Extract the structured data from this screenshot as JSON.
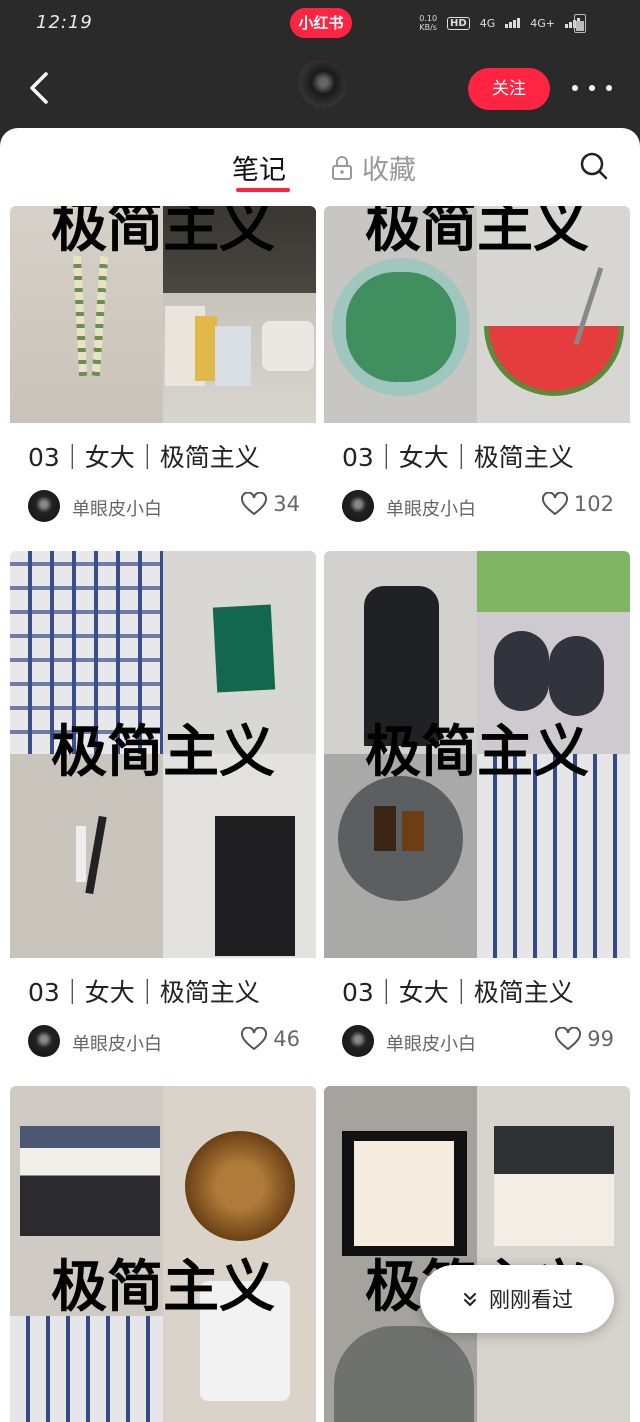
{
  "status": {
    "time": "12:19",
    "brand": "小红书",
    "net_speed_top": "0.10",
    "net_speed_bottom": "KB/s",
    "hd": "HD",
    "net1": "4G",
    "net2": "4G+"
  },
  "header": {
    "follow_label": "关注"
  },
  "tabs": {
    "notes": "笔记",
    "favorites": "收藏"
  },
  "notes": [
    {
      "title": "03｜女大｜极简主义",
      "author": "单眼皮小白",
      "likes": "34",
      "overlay": "极简主义"
    },
    {
      "title": "03｜女大｜极简主义",
      "author": "单眼皮小白",
      "likes": "102",
      "overlay": "极简主义"
    },
    {
      "title": "03｜女大｜极简主义",
      "author": "单眼皮小白",
      "likes": "46",
      "overlay": "极简主义"
    },
    {
      "title": "03｜女大｜极简主义",
      "author": "单眼皮小白",
      "likes": "99",
      "overlay": "极简主义"
    },
    {
      "overlay": "极简主义"
    },
    {
      "overlay": "极简主义"
    }
  ],
  "recent_button": {
    "label": "刚刚看过"
  },
  "colors": {
    "accent": "#ff2442"
  }
}
